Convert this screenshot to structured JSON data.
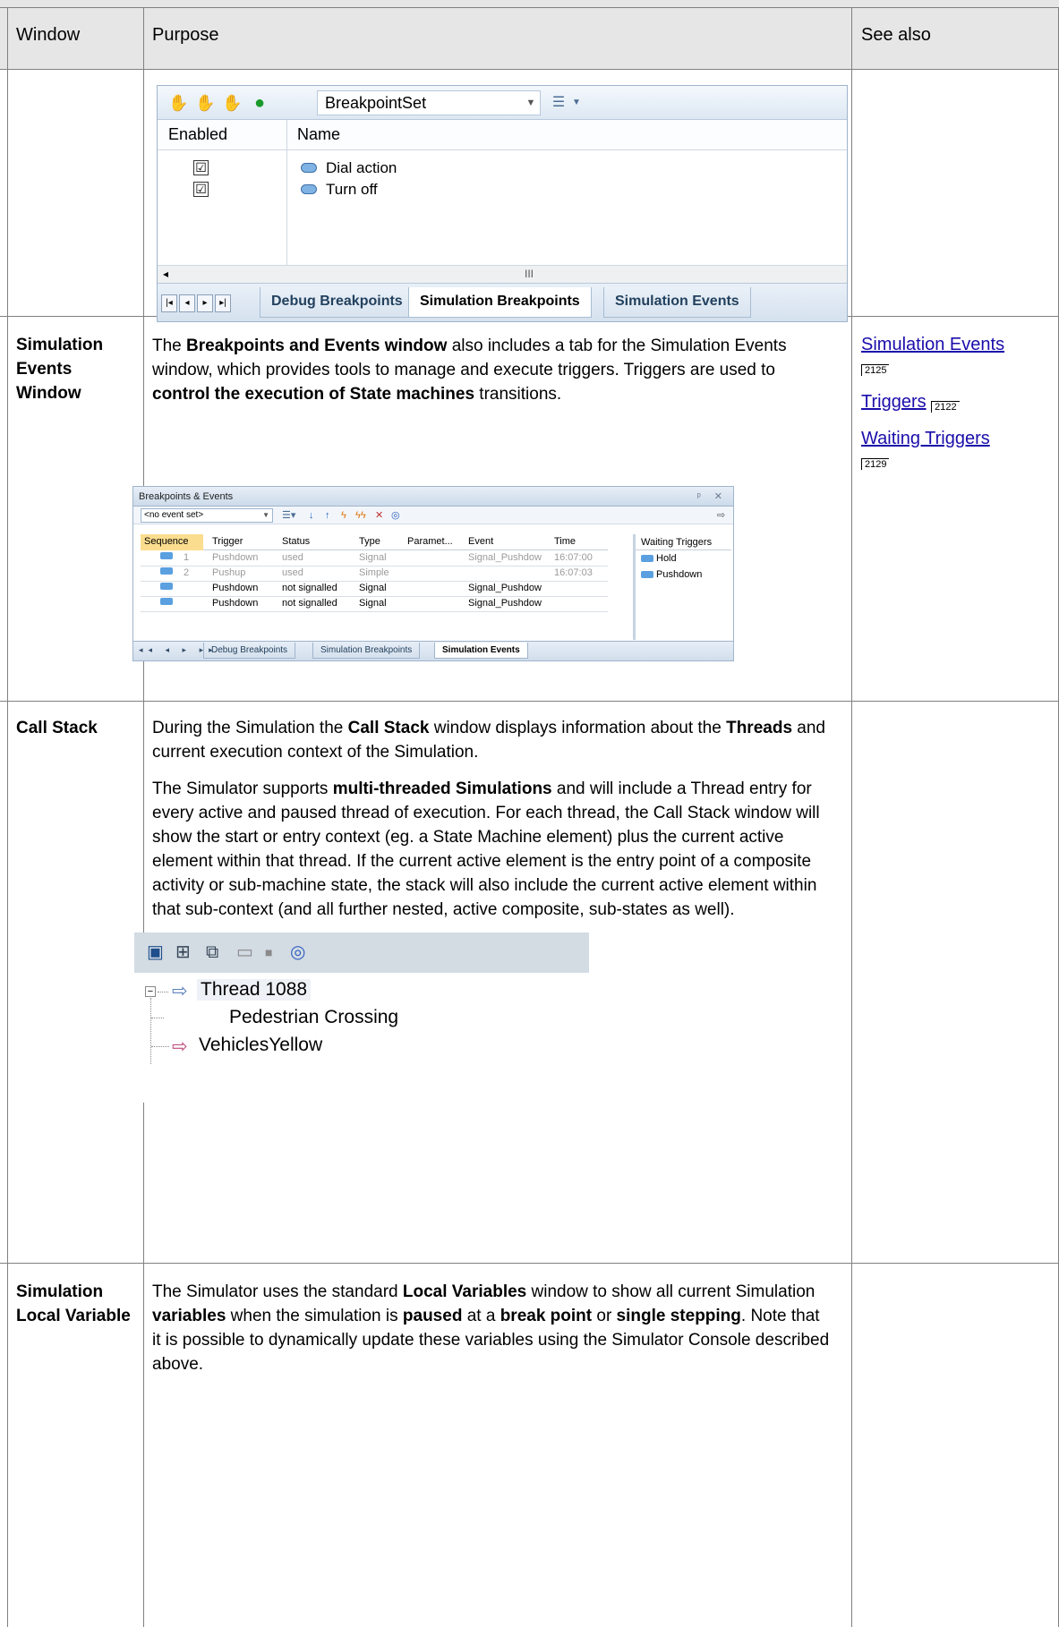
{
  "table": {
    "headers": {
      "window": "Window",
      "purpose": "Purpose",
      "see_also": "See also"
    },
    "row_breakpoints_screenshot": {
      "toolbar_combo": "BreakpointSet",
      "columns": {
        "enabled": "Enabled",
        "name": "Name"
      },
      "rows": [
        {
          "enabled": "☑",
          "name": "Dial action"
        },
        {
          "enabled": "☑",
          "name": "Turn off"
        }
      ],
      "scroll_glyph": "III",
      "tabs": [
        "Debug Breakpoints",
        "Simulation Breakpoints",
        "Simulation Events"
      ]
    },
    "row_sim_events": {
      "label": "Simulation Events Window",
      "text_1": "The ",
      "bold_1": "Breakpoints and Events window",
      "text_2": " also includes a tab for the Simulation Events window, which provides tools to manage and execute triggers. Triggers are used to ",
      "bold_2": "control the execution of State machines",
      "text_3": " transitions.",
      "see_also": [
        {
          "label": "Simulation Events",
          "page": "2125"
        },
        {
          "label": "Triggers",
          "page": "2122"
        },
        {
          "label": "Waiting Triggers",
          "page": "2129"
        }
      ],
      "screenshot": {
        "title": "Breakpoints & Events",
        "window_buttons": "ᵖ ✕",
        "combo": "<no event set>",
        "columns": [
          "Sequence",
          "Trigger",
          "Status",
          "Type",
          "Paramet...",
          "Event",
          "Time"
        ],
        "rows": [
          {
            "seq": "1",
            "trigger": "Pushdown",
            "status": "used",
            "type": "Signal",
            "param": "",
            "event": "Signal_Pushdow",
            "time": "16:07:00",
            "used": true
          },
          {
            "seq": "2",
            "trigger": "Pushup",
            "status": "used",
            "type": "Simple",
            "param": "",
            "event": "",
            "time": "16:07:03",
            "used": true
          },
          {
            "seq": "",
            "trigger": "Pushdown",
            "status": "not signalled",
            "type": "Signal",
            "param": "",
            "event": "Signal_Pushdow",
            "time": "",
            "used": false
          },
          {
            "seq": "",
            "trigger": "Pushdown",
            "status": "not signalled",
            "type": "Signal",
            "param": "",
            "event": "Signal_Pushdow",
            "time": "",
            "used": false
          }
        ],
        "waiting_header": "Waiting Triggers",
        "waiting": [
          "Hold",
          "Pushdown"
        ],
        "nav": "◂◂ ◂ ▸ ▸▸",
        "tabs": [
          "Debug Breakpoints",
          "Simulation Breakpoints",
          "Simulation Events"
        ]
      }
    },
    "row_call_stack": {
      "label": "Call Stack",
      "p1_a": "During the Simulation the ",
      "p1_b": "Call Stack",
      "p1_c": " window displays information about the ",
      "p1_d": "Threads",
      "p1_e": " and current execution context of the Simulation.",
      "p2_a": "The Simulator supports ",
      "p2_b": "multi-threaded Simulations",
      "p2_c": " and will include a Thread entry for every active and paused thread of execution. For each thread, the Call Stack window will show the start or entry context (eg. a State Machine element) plus the current active element within that thread. If the current active element is the entry point of a composite activity or sub-machine state, the stack will also include the current active element within that sub-context (and all further nested, active composite, sub-states as well).",
      "screenshot": {
        "thread": "Thread 1088",
        "context": "Pedestrian Crossing",
        "active": "VehiclesYellow"
      }
    },
    "row_local_var": {
      "label": "Simulation Local Variable",
      "t1": "The Simulator uses the standard ",
      "b1": "Local Variables",
      "t2": " window to show all current Simulation ",
      "b2": "variables",
      "t3": " when the simulation is ",
      "b3": "paused",
      "t4": " at a ",
      "b4": "break point",
      "t5": " or ",
      "b5": "single stepping",
      "t6": ". Note that it is possible to dynamically update these variables using the Simulator Console described above."
    }
  }
}
